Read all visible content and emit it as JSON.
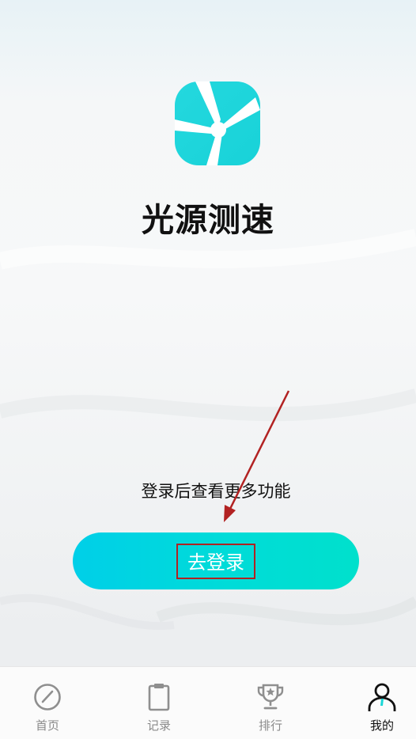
{
  "app": {
    "name": "光源测速"
  },
  "main": {
    "prompt": "登录后查看更多功能",
    "login_button": "去登录"
  },
  "tabbar": {
    "items": [
      {
        "label": "首页",
        "icon": "speedometer-icon",
        "active": false
      },
      {
        "label": "记录",
        "icon": "clipboard-icon",
        "active": false
      },
      {
        "label": "排行",
        "icon": "trophy-icon",
        "active": false
      },
      {
        "label": "我的",
        "icon": "person-icon",
        "active": true
      }
    ]
  },
  "colors": {
    "accent_start": "#00cfe8",
    "accent_end": "#00e0cc",
    "annotation": "#b22222"
  }
}
